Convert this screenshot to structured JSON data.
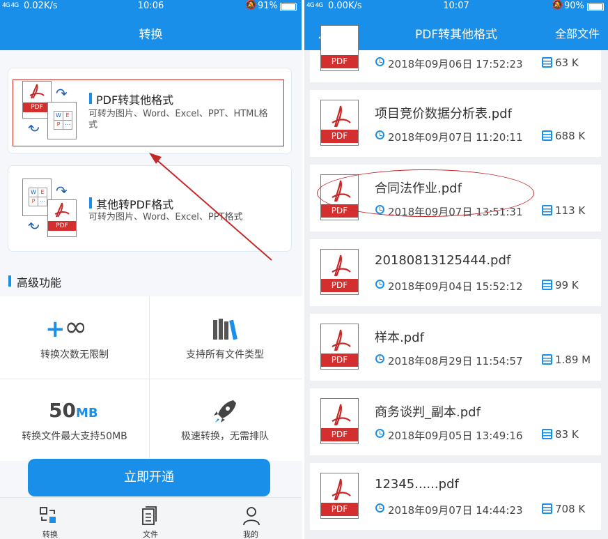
{
  "left": {
    "status": {
      "signal": "4G 4G",
      "speed": "0.02K/s",
      "time": "10:06",
      "battery": "91%"
    },
    "title": "转换",
    "cards": [
      {
        "title": "PDF转其他格式",
        "desc": "可转为图片、Word、Excel、PPT、HTML格式",
        "icon_label": "PDF"
      },
      {
        "title": "其他转PDF格式",
        "desc": "可转为图片、Word、Excel、PPT格式",
        "icon_label": "PDF"
      }
    ],
    "section_title": "高级功能",
    "features": [
      {
        "label": "转换次数无限制",
        "icon": "plus-infinity-icon"
      },
      {
        "label": "支持所有文件类型",
        "icon": "books-icon"
      },
      {
        "label": "转换文件最大支持50MB",
        "big_num": "50",
        "big_unit": "MB"
      },
      {
        "label": "极速转换，无需排队",
        "icon": "rocket-icon"
      }
    ],
    "open_button": "立即开通",
    "tabs": [
      {
        "label": "转换",
        "icon": "convert-icon"
      },
      {
        "label": "文件",
        "icon": "file-icon"
      },
      {
        "label": "我的",
        "icon": "user-icon"
      }
    ]
  },
  "right": {
    "status": {
      "signal": "4G 4G",
      "speed": "0.00K/s",
      "time": "10:07",
      "battery": "90%"
    },
    "title": "PDF转其他格式",
    "action": "全部文件",
    "top_partial": {
      "date": "2018年09月06日 17:52:23",
      "size": "63 K",
      "icon_label": "PDF"
    },
    "files": [
      {
        "name": "项目竞价数据分析表.pdf",
        "date": "2018年09月07日 11:20:11",
        "size": "688 K"
      },
      {
        "name": "合同法作业.pdf",
        "date": "2018年09月07日 13:51:31",
        "size": "113 K"
      },
      {
        "name": "20180813125444.pdf",
        "date": "2018年09月04日 15:52:12",
        "size": "99 K"
      },
      {
        "name": "样本.pdf",
        "date": "2018年08月29日 11:54:57",
        "size": "1.89 M"
      },
      {
        "name": "商务谈判_副本.pdf",
        "date": "2018年09月05日 13:49:16",
        "size": "83 K"
      },
      {
        "name": "12345......pdf",
        "date": "2018年09月07日 14:44:23",
        "size": "708 K"
      }
    ],
    "pdf_label": "PDF"
  },
  "colors": {
    "primary": "#1a8fea",
    "pdf_red": "#d32f2f",
    "annotation_red": "#c62828"
  }
}
